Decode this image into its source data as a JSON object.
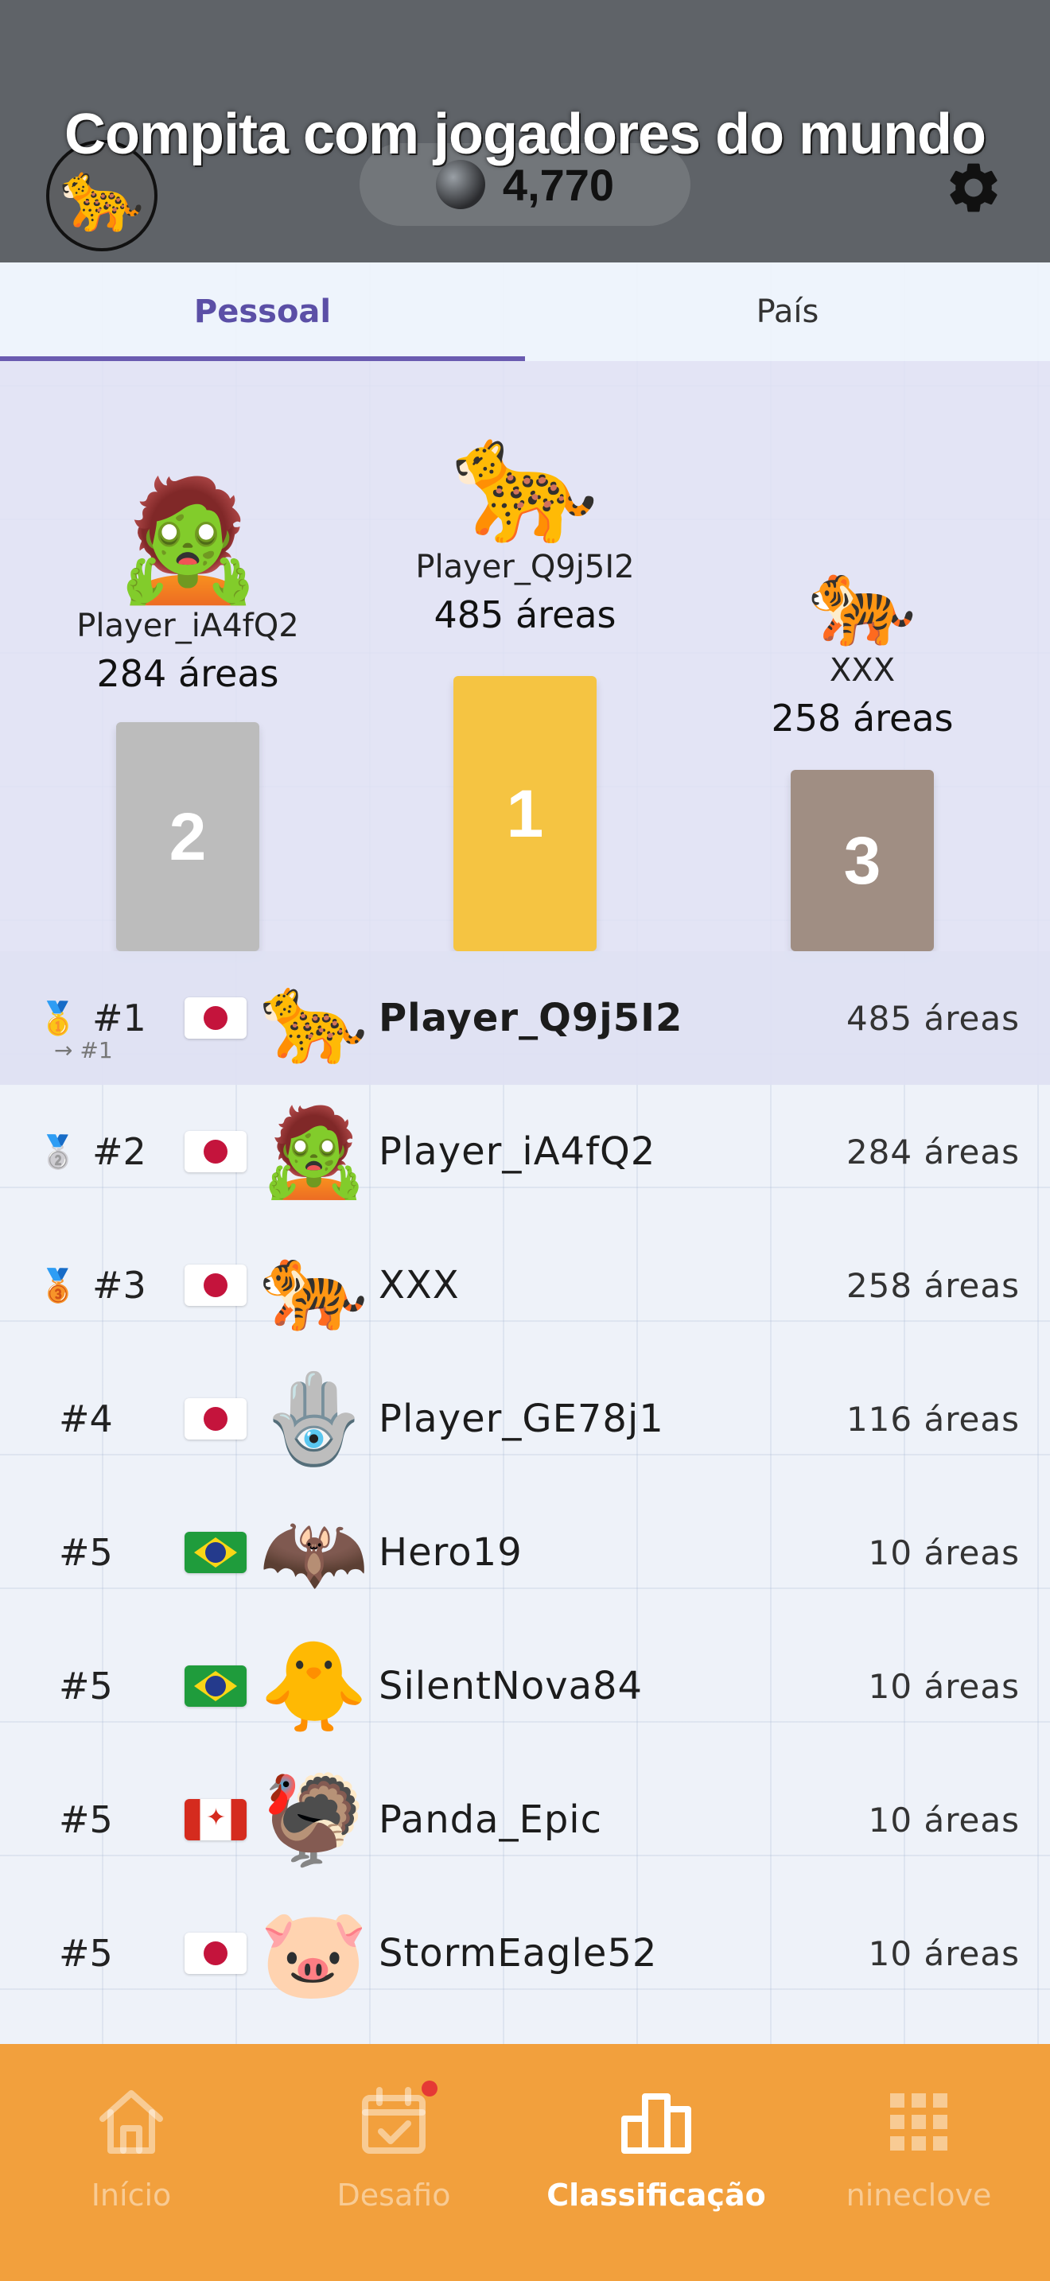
{
  "header": {
    "title": "Compita com jogadores do mundo",
    "profile_avatar": "🐆",
    "coins": "4,770",
    "settings_icon": "gear-icon"
  },
  "tabs": [
    {
      "label": "Pessoal",
      "active": true
    },
    {
      "label": "País",
      "active": false
    }
  ],
  "podium": {
    "first": {
      "name": "Player_Q9j5I2",
      "score": "485 áreas",
      "avatar": "🐆",
      "place": "1"
    },
    "second": {
      "name": "Player_iA4fQ2",
      "score": "284 áreas",
      "avatar": "🧟",
      "place": "2"
    },
    "third": {
      "name": "XXX",
      "score": "258 áreas",
      "avatar": "🐅",
      "place": "3"
    }
  },
  "leaderboard": [
    {
      "medal": "🥇",
      "rank": "#1",
      "rank_sub": "→ #1",
      "flag": "jp",
      "avatar": "🐆",
      "name": "Player_Q9j5I2",
      "score": "485 áreas",
      "is_me": true
    },
    {
      "medal": "🥈",
      "rank": "#2",
      "flag": "jp",
      "avatar": "🧟",
      "name": "Player_iA4fQ2",
      "score": "284 áreas"
    },
    {
      "medal": "🥉",
      "rank": "#3",
      "flag": "jp",
      "avatar": "🐅",
      "name": "XXX",
      "score": "258 áreas"
    },
    {
      "rank": "#4",
      "flag": "jp",
      "avatar": "🪬",
      "name": "Player_GE78j1",
      "score": "116 áreas"
    },
    {
      "rank": "#5",
      "flag": "br",
      "avatar": "🦇",
      "name": "Hero19",
      "score": "10 áreas"
    },
    {
      "rank": "#5",
      "flag": "br",
      "avatar": "🐥",
      "name": "SilentNova84",
      "score": "10 áreas"
    },
    {
      "rank": "#5",
      "flag": "ca",
      "avatar": "🦃",
      "name": "Panda_Epic",
      "score": "10 áreas"
    },
    {
      "rank": "#5",
      "flag": "jp",
      "avatar": "🐷",
      "name": "StormEagle52",
      "score": "10 áreas"
    }
  ],
  "bottom_nav": [
    {
      "label": "Início",
      "icon": "home-icon",
      "active": false
    },
    {
      "label": "Desafio",
      "icon": "calendar-check-icon",
      "active": false,
      "notification": true
    },
    {
      "label": "Classificação",
      "icon": "leaderboard-icon",
      "active": true
    },
    {
      "label": "nineclove",
      "icon": "grid-icon",
      "active": false
    }
  ],
  "colors": {
    "header_bg": "#5f6368",
    "accent_purple": "#6a5bb0",
    "gold": "#f5c442",
    "silver": "#bcbcbc",
    "bronze": "#a08e83",
    "nav_bg": "#f2a03d"
  }
}
